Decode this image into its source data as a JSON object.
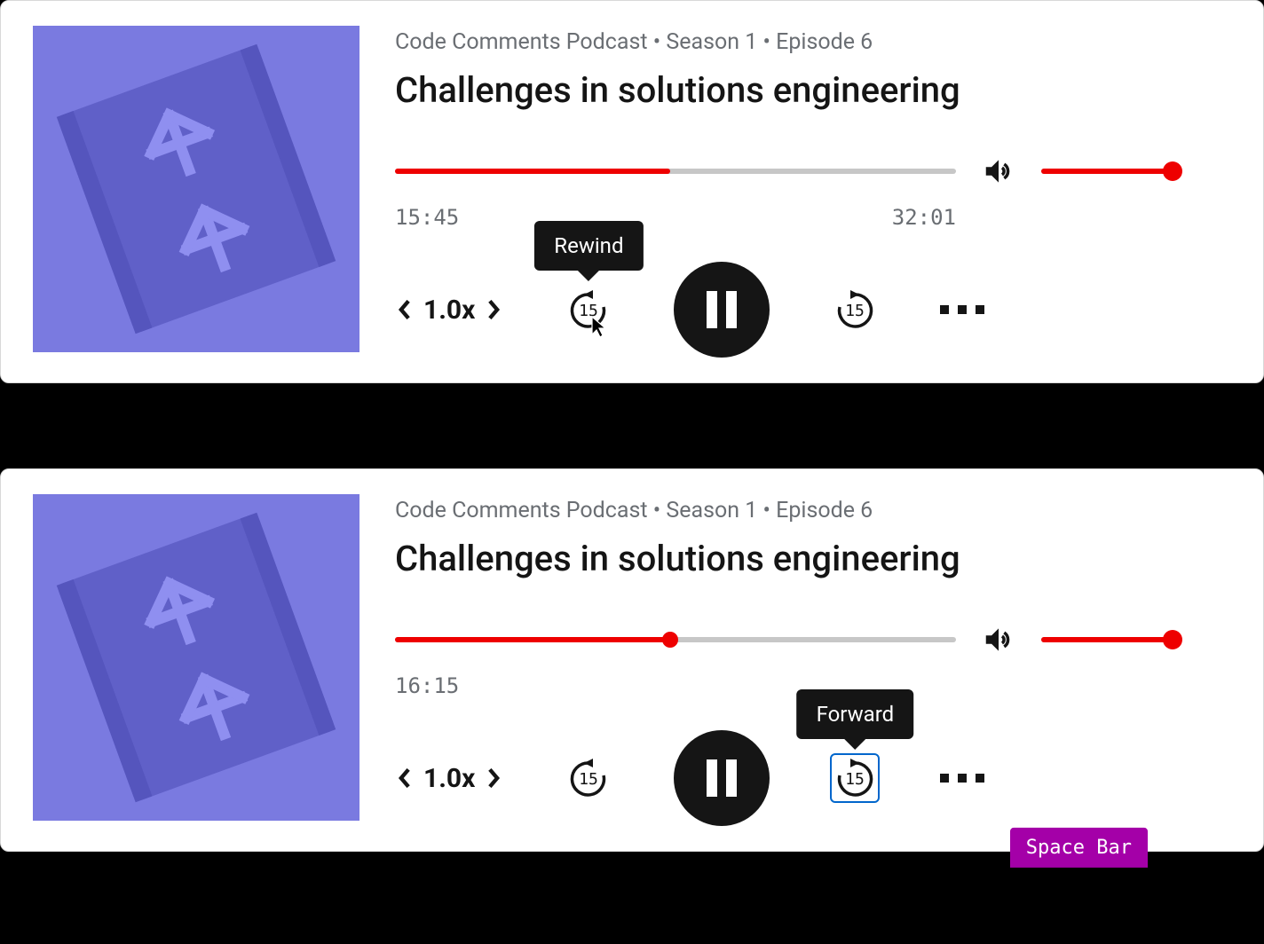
{
  "players": [
    {
      "breadcrumb": "Code Comments Podcast • Season 1 • Episode 6",
      "title": "Challenges in solutions engineering",
      "elapsed": "15:45",
      "duration": "32:01",
      "seek_percent": 49,
      "show_seek_thumb": false,
      "volume_percent": 100,
      "speed": "1.0x",
      "skip_seconds": "15",
      "tooltip": {
        "text": "Rewind",
        "target": "rewind"
      },
      "forward_focused": false,
      "show_cursor": true,
      "keycap": null
    },
    {
      "breadcrumb": "Code Comments Podcast • Season 1 • Episode 6",
      "title": "Challenges in solutions engineering",
      "elapsed": "16:15",
      "duration": "",
      "seek_percent": 49,
      "show_seek_thumb": true,
      "volume_percent": 100,
      "speed": "1.0x",
      "skip_seconds": "15",
      "tooltip": {
        "text": "Forward",
        "target": "forward"
      },
      "forward_focused": true,
      "show_cursor": false,
      "keycap": "Space Bar"
    }
  ]
}
